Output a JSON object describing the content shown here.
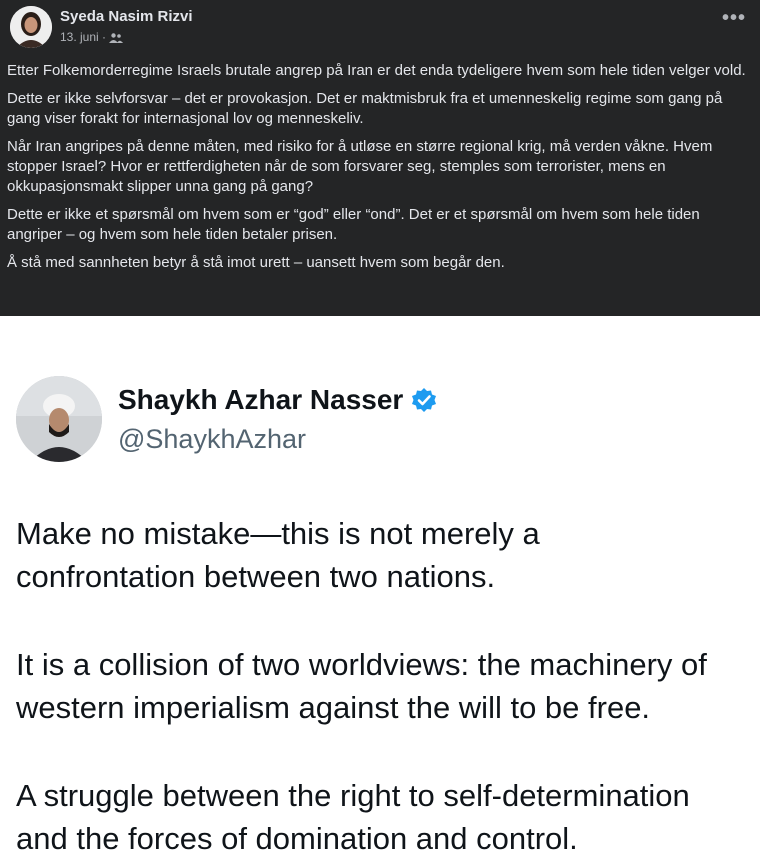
{
  "facebook_post": {
    "author": "Syeda Nasim Rizvi",
    "date": "13. juni ·",
    "audience_icon": "friends-icon",
    "more_icon": "•••",
    "paragraphs": [
      "Etter Folkemorderregime  Israels brutale angrep på Iran er det enda tydeligere hvem som hele tiden velger vold.",
      "Dette er ikke selvforsvar – det er provokasjon. Det er maktmisbruk fra et umenneskelig regime  som gang på gang viser forakt for internasjonal lov og menneskeliv.",
      "Når Iran angripes på denne måten, med risiko for å utløse en større regional krig, må verden våkne. Hvem stopper Israel? Hvor er rettferdigheten når de som forsvarer seg, stemples som terrorister, mens en okkupasjonsmakt slipper unna gang på gang?",
      "Dette er ikke et spørsmål om hvem som er “god” eller “ond”. Det er et spørsmål om hvem som hele tiden angriper – og hvem som hele tiden betaler prisen.",
      "Å stå med sannheten betyr å stå imot urett – uansett hvem som begår den."
    ],
    "colors": {
      "background": "#242526",
      "text": "#e4e6eb",
      "meta": "#b0b3b8"
    }
  },
  "tweet": {
    "name": "Shaykh Azhar Nasser",
    "handle": "@ShaykhAzhar",
    "verified_icon": "verified-badge-icon",
    "paragraphs": [
      {
        "lines": [
          "Make no mistake—this is not merely a",
          "confrontation between two nations."
        ]
      },
      {
        "lines": [
          "It is a collision of two worldviews: the machinery of",
          "western imperialism against the will to be free."
        ]
      },
      {
        "lines": [
          "A struggle between the right to self-determination",
          "and the forces of domination and control."
        ]
      }
    ],
    "colors": {
      "name": "#0f1419",
      "handle": "#536471",
      "verified": "#1d9bf0"
    }
  }
}
